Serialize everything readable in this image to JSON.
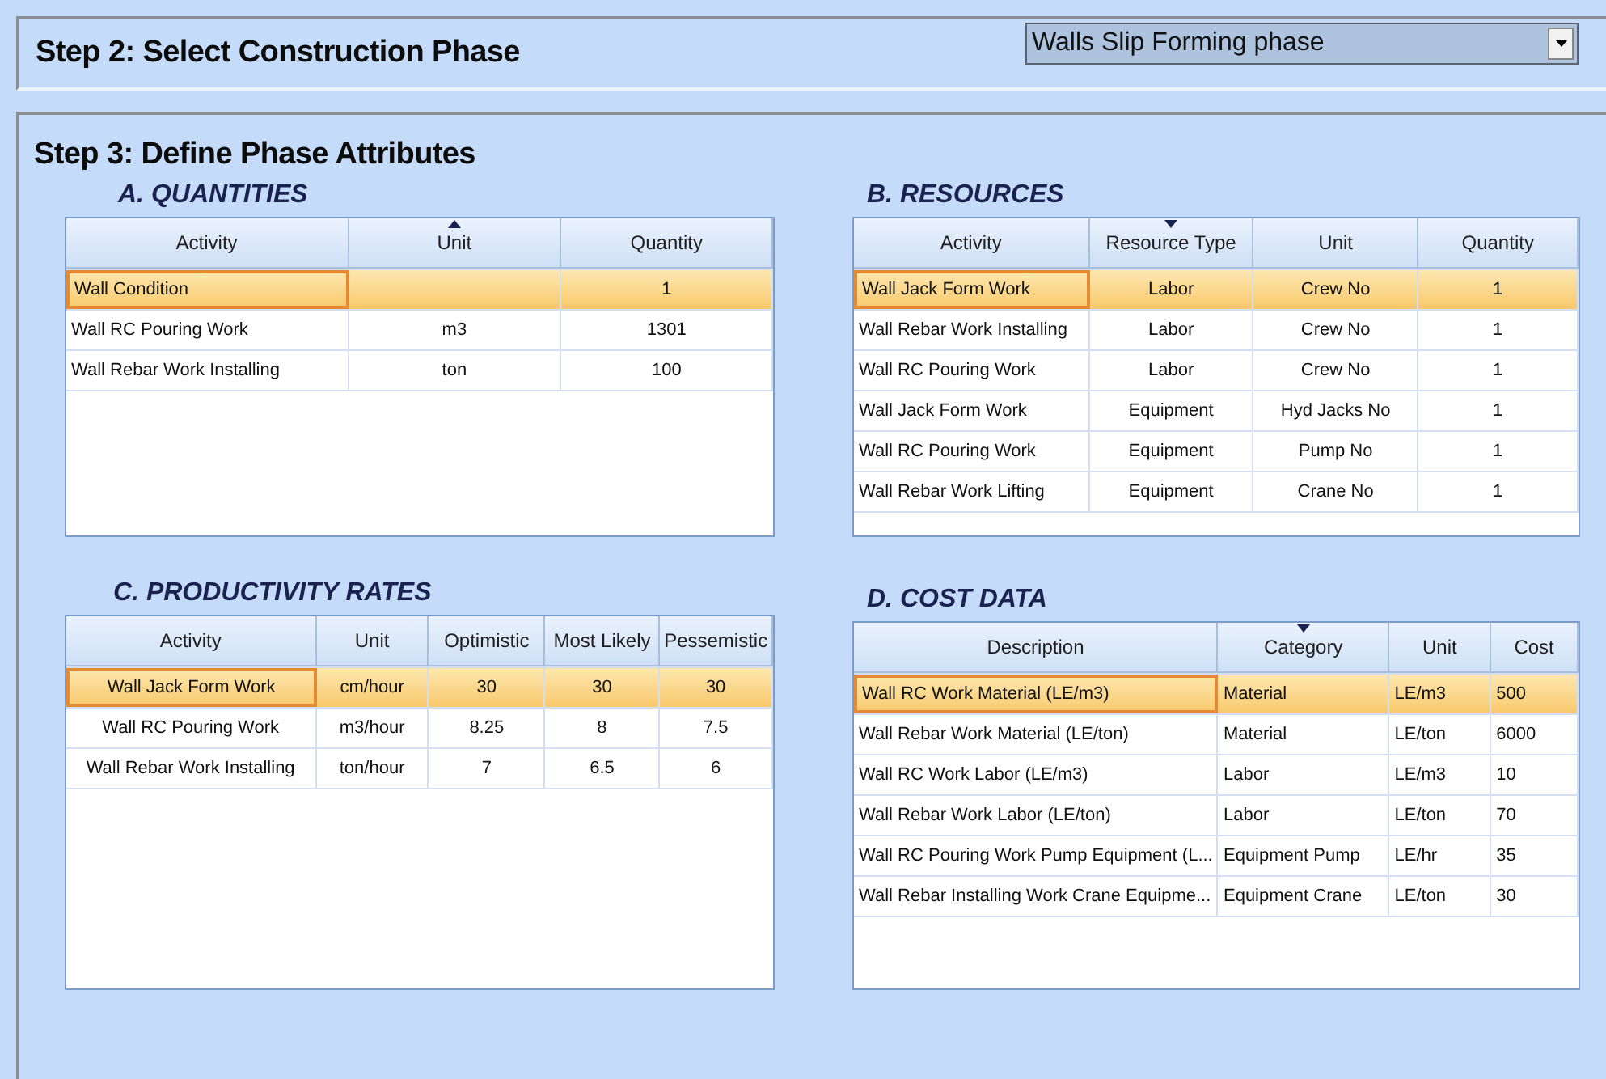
{
  "step2": {
    "title": "Step 2:  Select Construction Phase",
    "phase_select": {
      "value": "Walls Slip Forming phase"
    }
  },
  "step3": {
    "title": "Step 3: Define Phase Attributes"
  },
  "sections": [
    {
      "title": "A. QUANTITIES",
      "columns": [
        {
          "label": "Activity",
          "sorted_ascending": false,
          "sorted_descending": false
        },
        {
          "label": "Unit",
          "sorted_ascending": true,
          "sorted_descending": false
        },
        {
          "label": "Quantity",
          "sorted_ascending": false,
          "sorted_descending": false
        }
      ],
      "rows": [
        {
          "selected": true,
          "cells": [
            "Wall Condition",
            "",
            "1"
          ]
        },
        {
          "selected": false,
          "cells": [
            "Wall RC Pouring Work",
            "m3",
            "1301"
          ]
        },
        {
          "selected": false,
          "cells": [
            "Wall Rebar Work Installing",
            "ton",
            "100"
          ]
        }
      ]
    },
    {
      "title": "B. RESOURCES",
      "columns": [
        {
          "label": "Activity",
          "sorted_ascending": false,
          "sorted_descending": false
        },
        {
          "label": "Resource Type",
          "sorted_ascending": false,
          "sorted_descending": true
        },
        {
          "label": "Unit",
          "sorted_ascending": false,
          "sorted_descending": false
        },
        {
          "label": "Quantity",
          "sorted_ascending": false,
          "sorted_descending": false
        }
      ],
      "rows": [
        {
          "selected": true,
          "cells": [
            "Wall Jack Form Work",
            "Labor",
            "Crew No",
            "1"
          ]
        },
        {
          "selected": false,
          "cells": [
            "Wall Rebar Work Installing",
            "Labor",
            "Crew No",
            "1"
          ]
        },
        {
          "selected": false,
          "cells": [
            "Wall RC Pouring Work",
            "Labor",
            "Crew No",
            "1"
          ]
        },
        {
          "selected": false,
          "cells": [
            "Wall Jack Form Work",
            "Equipment",
            "Hyd Jacks No",
            "1"
          ]
        },
        {
          "selected": false,
          "cells": [
            "Wall RC Pouring Work",
            "Equipment",
            "Pump No",
            "1"
          ]
        },
        {
          "selected": false,
          "cells": [
            "Wall Rebar Work Lifting",
            "Equipment",
            "Crane No",
            "1"
          ]
        }
      ]
    },
    {
      "title": "C. PRODUCTIVITY RATES",
      "columns": [
        {
          "label": "Activity",
          "sorted_ascending": false,
          "sorted_descending": false
        },
        {
          "label": "Unit",
          "sorted_ascending": false,
          "sorted_descending": false
        },
        {
          "label": "Optimistic",
          "sorted_ascending": false,
          "sorted_descending": false
        },
        {
          "label": "Most Likely",
          "sorted_ascending": false,
          "sorted_descending": false
        },
        {
          "label": "Pessemistic",
          "sorted_ascending": false,
          "sorted_descending": false
        }
      ],
      "rows": [
        {
          "selected": true,
          "cells": [
            "Wall Jack Form Work",
            "cm/hour",
            "30",
            "30",
            "30"
          ]
        },
        {
          "selected": false,
          "cells": [
            "Wall RC Pouring Work",
            "m3/hour",
            "8.25",
            "8",
            "7.5"
          ]
        },
        {
          "selected": false,
          "cells": [
            "Wall Rebar Work Installing",
            "ton/hour",
            "7",
            "6.5",
            "6"
          ]
        }
      ]
    },
    {
      "title": "D. COST DATA",
      "columns": [
        {
          "label": "Description",
          "sorted_ascending": false,
          "sorted_descending": false
        },
        {
          "label": "Category",
          "sorted_ascending": false,
          "sorted_descending": true
        },
        {
          "label": "Unit",
          "sorted_ascending": false,
          "sorted_descending": false
        },
        {
          "label": "Cost",
          "sorted_ascending": false,
          "sorted_descending": false
        }
      ],
      "rows": [
        {
          "selected": true,
          "cells": [
            "Wall RC  Work Material (LE/m3)",
            "Material",
            "LE/m3",
            "500"
          ]
        },
        {
          "selected": false,
          "cells": [
            "Wall Rebar Work Material (LE/ton)",
            "Material",
            "LE/ton",
            "6000"
          ]
        },
        {
          "selected": false,
          "cells": [
            "Wall RC Work Labor (LE/m3)",
            "Labor",
            "LE/m3",
            "10"
          ]
        },
        {
          "selected": false,
          "cells": [
            "Wall Rebar Work Labor (LE/ton)",
            "Labor",
            "LE/ton",
            "70"
          ]
        },
        {
          "selected": false,
          "cells": [
            "Wall RC Pouring Work Pump Equipment (L...",
            "Equipment Pump",
            "LE/hr",
            "35"
          ]
        },
        {
          "selected": false,
          "cells": [
            "Wall Rebar Installing Work Crane Equipme...",
            "Equipment Crane",
            "LE/ton",
            "30"
          ]
        }
      ]
    }
  ]
}
